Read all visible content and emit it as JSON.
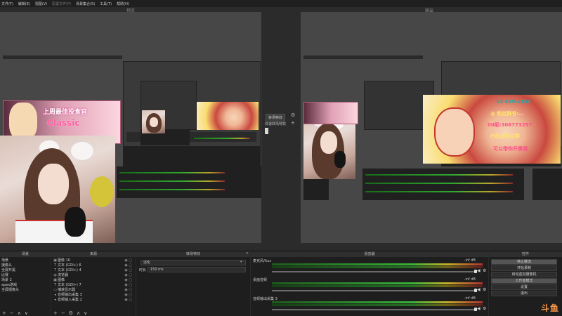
{
  "menubar": {
    "items": [
      "文件(F)",
      "编辑(E)",
      "视图(V)",
      "配置文件(P)",
      "场景集合(S)",
      "工具(T)",
      "帮助(H)"
    ]
  },
  "preview": {
    "title": "预览"
  },
  "program": {
    "title": "输出"
  },
  "overlay": {
    "banner_main": "上周最佳投食官",
    "banner_sub": "Classic",
    "art_lines": [
      "13-359-2153",
      "@ 粉丝群号:...",
      "00昵:306773297",
      "扫码加粉丝群",
      "可以带你开黑哦"
    ]
  },
  "transition": {
    "button_label": "转场特效",
    "quick_label": "快速转场特效",
    "add_symbol": "+"
  },
  "scenes": {
    "title": "场景",
    "items": [
      "场景",
      "摄像头",
      "全屏开黑",
      "比赛",
      "场景 2",
      "apex游戏",
      "全屏摄像头"
    ],
    "toolbar": [
      "+",
      "−",
      "∧",
      "∨"
    ]
  },
  "sources": {
    "title": "来源",
    "items": [
      {
        "icon": "image-icon",
        "glyph": "▣",
        "label": "图像 10"
      },
      {
        "icon": "text-icon",
        "glyph": "T",
        "label": "文本 (GDI+) 6"
      },
      {
        "icon": "text-icon",
        "glyph": "T",
        "label": "文本 (GDI+) 4"
      },
      {
        "icon": "browser-icon",
        "glyph": "◍",
        "label": "浏览器"
      },
      {
        "icon": "image-icon",
        "glyph": "▣",
        "label": "图像"
      },
      {
        "icon": "text-icon",
        "glyph": "T",
        "label": "文本 (GDI+) 7"
      },
      {
        "icon": "display-icon",
        "glyph": "▭",
        "label": "捕获显示器"
      },
      {
        "icon": "speaker-icon",
        "glyph": "◂",
        "label": "音频输出采集 3"
      },
      {
        "icon": "speaker-icon",
        "glyph": "◂",
        "label": "音频输入采集 2"
      }
    ],
    "toolbar": [
      "+",
      "−",
      "⚙",
      "∧",
      "∨"
    ]
  },
  "transitions_dock": {
    "title": "转场特效",
    "selected": "淡化",
    "duration_label": "时长",
    "duration_value": "150 ms"
  },
  "mixer": {
    "title": "混音器",
    "channels": [
      {
        "name": "麦克风/Aux",
        "db": "-inf dB",
        "level": 0.78
      },
      {
        "name": "桌面音频",
        "db": "-inf dB",
        "level": 0.72
      },
      {
        "name": "音频输出采集 3",
        "db": "-inf dB",
        "level": 0.7
      }
    ]
  },
  "controls": {
    "title": "控件",
    "buttons": [
      "停止推流",
      "开始录制",
      "启动虚拟摄像机",
      "工作室模式",
      "设置",
      "退出"
    ]
  },
  "watermark": "斗鱼"
}
